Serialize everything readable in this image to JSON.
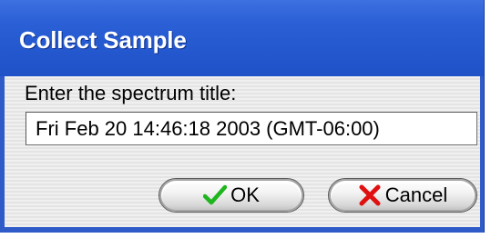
{
  "dialog": {
    "title": "Collect Sample",
    "prompt": "Enter the spectrum title:",
    "input_value": "Fri Feb 20 14:46:18 2003 (GMT-06:00)",
    "ok_label": "OK",
    "cancel_label": "Cancel"
  },
  "icons": {
    "ok": "checkmark-icon",
    "cancel": "x-cross-icon"
  },
  "colors": {
    "titlebar": "#2a5fd6",
    "title_text": "#ffffff",
    "client_bg": "#ececec",
    "checkmark": "#1fb51f",
    "cross": "#e01010"
  }
}
